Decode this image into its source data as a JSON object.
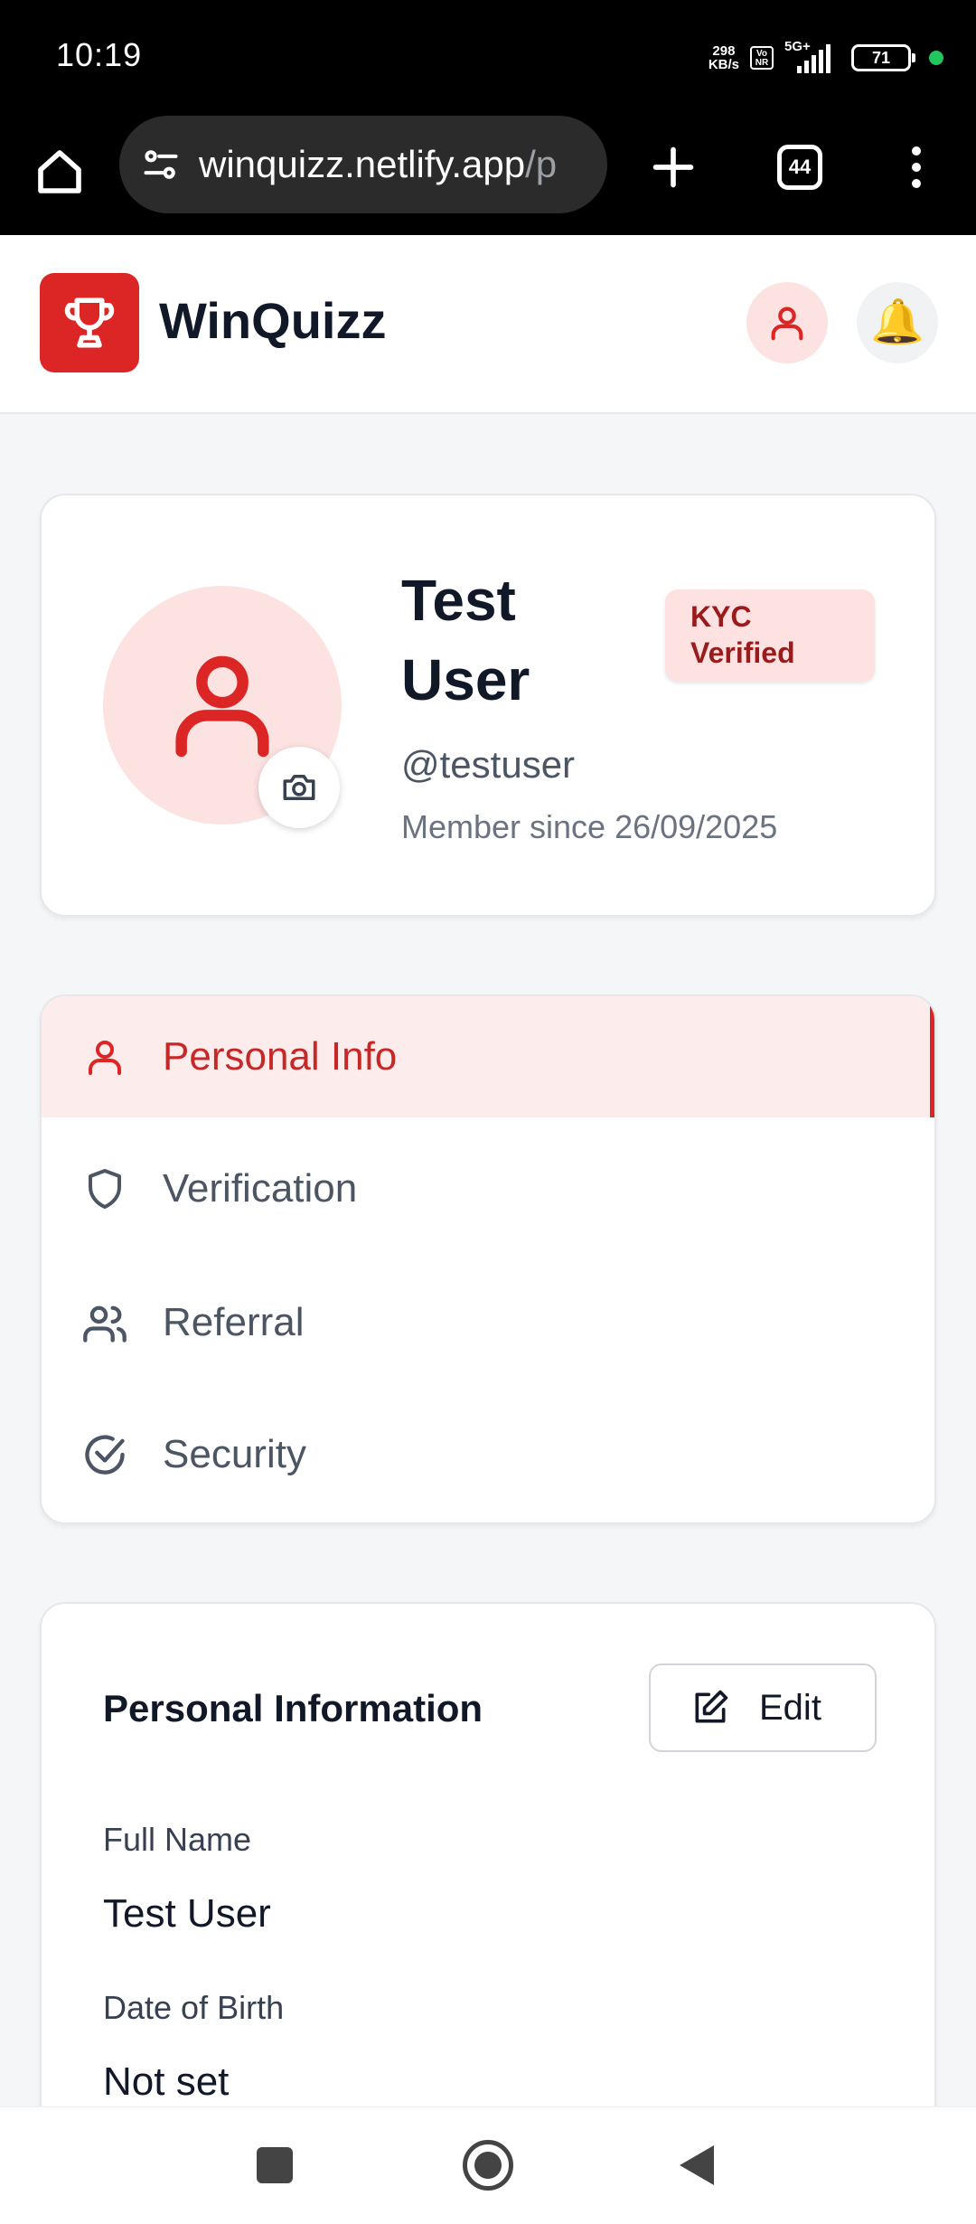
{
  "status_bar": {
    "time": "10:19",
    "net_speed_value": "298",
    "net_speed_unit": "KB/s",
    "volte_top": "Vo",
    "volte_bottom": "NR",
    "network": "5G+",
    "battery": "71"
  },
  "browser": {
    "url_main": "winquizz.netlify.app",
    "url_rest": "/p",
    "tab_count": "44"
  },
  "header": {
    "brand": "WinQuizz",
    "bell_emoji": "🔔"
  },
  "profile": {
    "name": "Test User",
    "kyc_badge": "KYC Verified",
    "username": "@testuser",
    "member_since": "Member since 26/09/2025"
  },
  "tabs": [
    {
      "label": "Personal Info",
      "icon": "user-icon",
      "active": true
    },
    {
      "label": "Verification",
      "icon": "shield-icon",
      "active": false
    },
    {
      "label": "Referral",
      "icon": "users-icon",
      "active": false
    },
    {
      "label": "Security",
      "icon": "check-circle-icon",
      "active": false
    }
  ],
  "personal_info": {
    "title": "Personal Information",
    "edit_label": "Edit",
    "fields": [
      {
        "label": "Full Name",
        "value": "Test User"
      },
      {
        "label": "Date of Birth",
        "value": "Not set"
      }
    ]
  },
  "colors": {
    "accent": "#dc2626",
    "accent_light": "#fde2e2",
    "badge_text": "#991b1b"
  }
}
